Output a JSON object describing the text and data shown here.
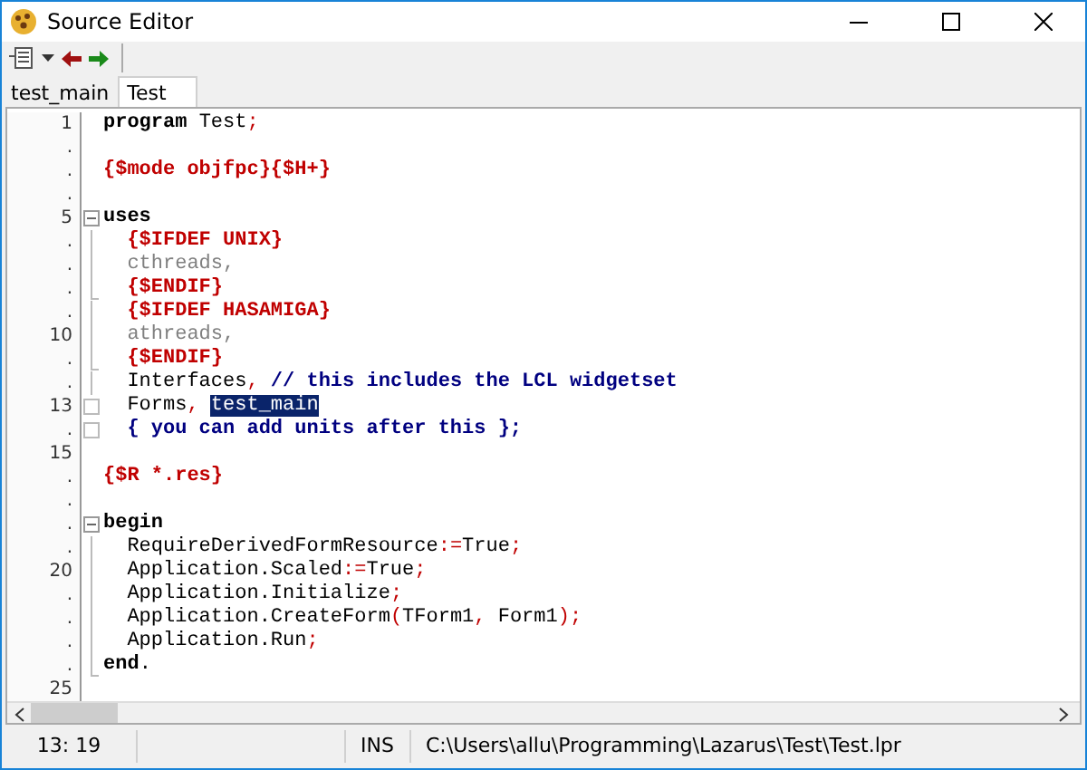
{
  "window": {
    "title": "Source Editor"
  },
  "tabs": [
    {
      "label": "test_main",
      "selected": false
    },
    {
      "label": "Test",
      "selected": true
    }
  ],
  "editor": {
    "lines": [
      {
        "number": "1",
        "kind": "plain",
        "tokens": [
          {
            "kind": "keyword",
            "text": "program"
          },
          {
            "kind": "ident",
            "text": " Test"
          },
          {
            "kind": "symbol",
            "text": ";"
          }
        ]
      },
      {
        "number": ".",
        "kind": "plain"
      },
      {
        "number": ".",
        "kind": "plain",
        "tokens": [
          {
            "kind": "directive",
            "text": "{$mode objfpc}{$H+}"
          }
        ]
      },
      {
        "number": ".",
        "kind": "plain"
      },
      {
        "number": "5",
        "kind": "fold_start",
        "tokens": [
          {
            "kind": "keyword",
            "text": "uses"
          }
        ]
      },
      {
        "number": ".",
        "kind": "fold_guide",
        "tokens": [
          {
            "kind": "directive",
            "text": "  {$IFDEF UNIX}"
          }
        ]
      },
      {
        "number": ".",
        "kind": "fold_guide",
        "tokens": [
          {
            "kind": "inactive",
            "text": "  cthreads,"
          }
        ]
      },
      {
        "number": ".",
        "kind": "fold_end",
        "tokens": [
          {
            "kind": "directive",
            "text": "  {$ENDIF}"
          }
        ]
      },
      {
        "number": ".",
        "kind": "fold_guide",
        "tokens": [
          {
            "kind": "directive",
            "text": "  {$IFDEF HASAMIGA}"
          }
        ]
      },
      {
        "number": "10",
        "kind": "fold_guide",
        "tokens": [
          {
            "kind": "inactive",
            "text": "  athreads,"
          }
        ]
      },
      {
        "number": ".",
        "kind": "fold_end",
        "tokens": [
          {
            "kind": "directive",
            "text": "  {$ENDIF}"
          }
        ]
      },
      {
        "number": ".",
        "kind": "fold_guide",
        "tokens": [
          {
            "kind": "ident",
            "text": "  Interfaces"
          },
          {
            "kind": "symbol",
            "text": ","
          },
          {
            "kind": "comment",
            "text": " // this includes the LCL widgetset"
          }
        ]
      },
      {
        "number": "13",
        "kind": "fold_box",
        "tokens": [
          {
            "kind": "ident",
            "text": "  Forms"
          },
          {
            "kind": "symbol",
            "text": ", "
          },
          {
            "kind": "selection",
            "text": "test_main"
          }
        ]
      },
      {
        "number": ".",
        "kind": "fold_box",
        "tokens": [
          {
            "kind": "comment",
            "text": "  { you can add units after this };"
          }
        ]
      },
      {
        "number": "15",
        "kind": "plain"
      },
      {
        "number": ".",
        "kind": "plain",
        "tokens": [
          {
            "kind": "directive",
            "text": "{$R *.res}"
          }
        ]
      },
      {
        "number": ".",
        "kind": "plain"
      },
      {
        "number": ".",
        "kind": "fold_start",
        "tokens": [
          {
            "kind": "keyword",
            "text": "begin"
          }
        ]
      },
      {
        "number": ".",
        "kind": "fold_guide",
        "tokens": [
          {
            "kind": "ident",
            "text": "  RequireDerivedFormResource"
          },
          {
            "kind": "symbol",
            "text": ":="
          },
          {
            "kind": "ident",
            "text": "True"
          },
          {
            "kind": "symbol",
            "text": ";"
          }
        ]
      },
      {
        "number": "20",
        "kind": "fold_guide",
        "tokens": [
          {
            "kind": "ident",
            "text": "  Application.Scaled"
          },
          {
            "kind": "symbol",
            "text": ":="
          },
          {
            "kind": "ident",
            "text": "True"
          },
          {
            "kind": "symbol",
            "text": ";"
          }
        ]
      },
      {
        "number": ".",
        "kind": "fold_guide",
        "tokens": [
          {
            "kind": "ident",
            "text": "  Application.Initialize"
          },
          {
            "kind": "symbol",
            "text": ";"
          }
        ]
      },
      {
        "number": ".",
        "kind": "fold_guide",
        "tokens": [
          {
            "kind": "ident",
            "text": "  Application.CreateForm"
          },
          {
            "kind": "symbol",
            "text": "("
          },
          {
            "kind": "ident",
            "text": "TForm1"
          },
          {
            "kind": "symbol",
            "text": ", "
          },
          {
            "kind": "ident",
            "text": "Form1"
          },
          {
            "kind": "symbol",
            "text": ");"
          }
        ]
      },
      {
        "number": ".",
        "kind": "fold_guide",
        "tokens": [
          {
            "kind": "ident",
            "text": "  Application.Run"
          },
          {
            "kind": "symbol",
            "text": ";"
          }
        ]
      },
      {
        "number": ".",
        "kind": "fold_end",
        "tokens": [
          {
            "kind": "keyword",
            "text": "end"
          },
          {
            "kind": "ident",
            "text": "."
          }
        ]
      },
      {
        "number": "25",
        "kind": "plain"
      }
    ]
  },
  "status_bar": {
    "position": "13: 19",
    "mode": "INS",
    "file_path": "C:\\Users\\allu\\Programming\\Lazarus\\Test\\Test.lpr"
  }
}
